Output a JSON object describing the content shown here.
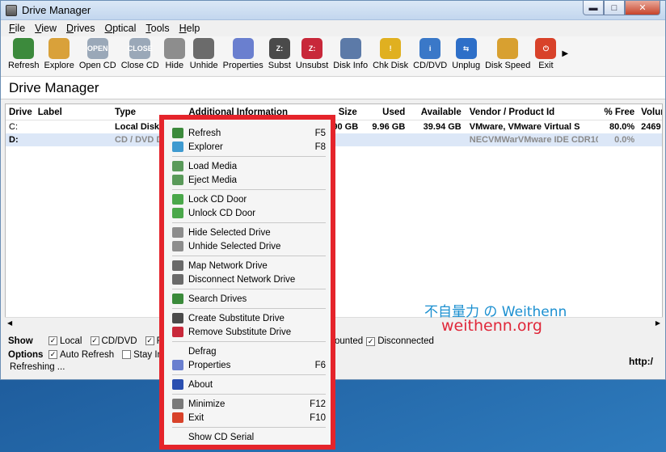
{
  "window": {
    "title": "Drive Manager"
  },
  "menu": [
    {
      "label": "File",
      "u": "F",
      "rest": "ile"
    },
    {
      "label": "View",
      "u": "V",
      "rest": "iew"
    },
    {
      "label": "Drives",
      "u": "D",
      "rest": "rives"
    },
    {
      "label": "Optical",
      "u": "O",
      "rest": "ptical"
    },
    {
      "label": "Tools",
      "u": "T",
      "rest": "ools"
    },
    {
      "label": "Help",
      "u": "H",
      "rest": "elp"
    }
  ],
  "toolbar": [
    {
      "label": "Refresh",
      "icon": "refresh-icon",
      "color": "#3c8a3c",
      "glyph": ""
    },
    {
      "label": "Explore",
      "icon": "explore-icon",
      "color": "#d9a13a",
      "glyph": ""
    },
    {
      "label": "Open CD",
      "icon": "open-cd-icon",
      "color": "#9aa8b8",
      "glyph": "OPEN"
    },
    {
      "label": "Close CD",
      "icon": "close-cd-icon",
      "color": "#9aa8b8",
      "glyph": "CLOSE"
    },
    {
      "label": "Hide",
      "icon": "hide-icon",
      "color": "#8d8d8d",
      "glyph": ""
    },
    {
      "label": "Unhide",
      "icon": "unhide-icon",
      "color": "#6b6b6b",
      "glyph": ""
    },
    {
      "label": "Properties",
      "icon": "properties-icon",
      "color": "#6a7fcf",
      "glyph": ""
    },
    {
      "label": "Subst",
      "icon": "subst-icon",
      "color": "#4a4a4a",
      "glyph": "Z:"
    },
    {
      "label": "Unsubst",
      "icon": "unsubst-icon",
      "color": "#c8283a",
      "glyph": "Z:"
    },
    {
      "label": "Disk Info",
      "icon": "disk-info-icon",
      "color": "#5c7aa8",
      "glyph": ""
    },
    {
      "label": "Chk Disk",
      "icon": "chk-disk-icon",
      "color": "#e0b020",
      "glyph": "!"
    },
    {
      "label": "CD/DVD",
      "icon": "cd-dvd-icon",
      "color": "#3a78c8",
      "glyph": "i"
    },
    {
      "label": "Unplug",
      "icon": "unplug-icon",
      "color": "#2e6fc8",
      "glyph": "⇆"
    },
    {
      "label": "Disk Speed",
      "icon": "disk-speed-icon",
      "color": "#d8a030",
      "glyph": ""
    },
    {
      "label": "Exit",
      "icon": "exit-icon",
      "color": "#d8422a",
      "glyph": "⏻"
    }
  ],
  "header": {
    "title": "Drive Manager"
  },
  "columns": {
    "drive": "Drive",
    "label": "Label",
    "type": "Type",
    "additional": "Additional Information",
    "size": "Size",
    "used": "Used",
    "available": "Available",
    "vendor": "Vendor / Product Id",
    "free": "% Free",
    "volume": "Volum"
  },
  "rows": [
    {
      "drive": "C:",
      "label": "",
      "type": "Local Disk",
      "additional": "",
      "size": "49.90 GB",
      "used": "9.96 GB",
      "available": "39.94 GB",
      "vendor": "VMware, VMware Virtual S",
      "free": "80.0%",
      "volume": "2469 -"
    },
    {
      "drive": "D:",
      "label": "",
      "type": "CD / DVD Drive",
      "additional": "",
      "size": "",
      "used": "",
      "available": "",
      "vendor": "NECVMWarVMware IDE CDR10",
      "free": "0.0%",
      "volume": ""
    }
  ],
  "show": {
    "label": "Show",
    "local": "Local",
    "cddvd": "CD/DVD",
    "frag1": "R",
    "unmounted": "ounted",
    "disconnected": "Disconnected"
  },
  "options": {
    "label": "Options",
    "auto_refresh": "Auto Refresh",
    "stay": "Stay In"
  },
  "status": {
    "text": "Refreshing ...",
    "url": "http:/"
  },
  "context_menu": [
    {
      "label": "Refresh",
      "key": "F5",
      "icon": "refresh-icon",
      "color": "#3c8a3c",
      "sep_after": false
    },
    {
      "label": "Explorer",
      "key": "F8",
      "icon": "explorer-icon",
      "color": "#3f9ad0",
      "sep_after": true
    },
    {
      "label": "Load Media",
      "key": "",
      "icon": "load-media-icon",
      "color": "#5a9a5a",
      "sep_after": false
    },
    {
      "label": "Eject Media",
      "key": "",
      "icon": "eject-media-icon",
      "color": "#5a9a5a",
      "sep_after": true
    },
    {
      "label": "Lock CD Door",
      "key": "",
      "icon": "lock-cd-icon",
      "color": "#4aa84a",
      "sep_after": false
    },
    {
      "label": "Unlock CD Door",
      "key": "",
      "icon": "unlock-cd-icon",
      "color": "#4aa84a",
      "sep_after": true
    },
    {
      "label": "Hide Selected Drive",
      "key": "",
      "icon": "hide-drive-icon",
      "color": "#8d8d8d",
      "sep_after": false
    },
    {
      "label": "Unhide Selected Drive",
      "key": "",
      "icon": "unhide-drive-icon",
      "color": "#8d8d8d",
      "sep_after": true
    },
    {
      "label": "Map Network Drive",
      "key": "",
      "icon": "map-network-icon",
      "color": "#6a6a6a",
      "sep_after": false
    },
    {
      "label": "Disconnect Network Drive",
      "key": "",
      "icon": "disconnect-network-icon",
      "color": "#6a6a6a",
      "sep_after": true
    },
    {
      "label": "Search Drives",
      "key": "",
      "icon": "search-drives-icon",
      "color": "#3a8a3a",
      "sep_after": true
    },
    {
      "label": "Create Substitute Drive",
      "key": "",
      "icon": "create-subst-icon",
      "color": "#4a4a4a",
      "sep_after": false
    },
    {
      "label": "Remove Substitute Drive",
      "key": "",
      "icon": "remove-subst-icon",
      "color": "#c8283a",
      "sep_after": true
    },
    {
      "label": "Defrag",
      "key": "",
      "icon": "",
      "color": "",
      "sep_after": false
    },
    {
      "label": "Properties",
      "key": "F6",
      "icon": "properties-icon",
      "color": "#6a7fcf",
      "sep_after": true
    },
    {
      "label": "About",
      "key": "",
      "icon": "about-icon",
      "color": "#2a4fb0",
      "sep_after": true
    },
    {
      "label": "Minimize",
      "key": "F12",
      "icon": "minimize-icon",
      "color": "#7a7a7a",
      "sep_after": false
    },
    {
      "label": "Exit",
      "key": "F10",
      "icon": "exit-icon",
      "color": "#d8422a",
      "sep_after": true
    },
    {
      "label": "Show CD Serial",
      "key": "",
      "icon": "",
      "color": "",
      "sep_after": false
    }
  ],
  "watermark": {
    "line1": "不自量力 の Weithenn",
    "line2": "weithenn.org"
  }
}
